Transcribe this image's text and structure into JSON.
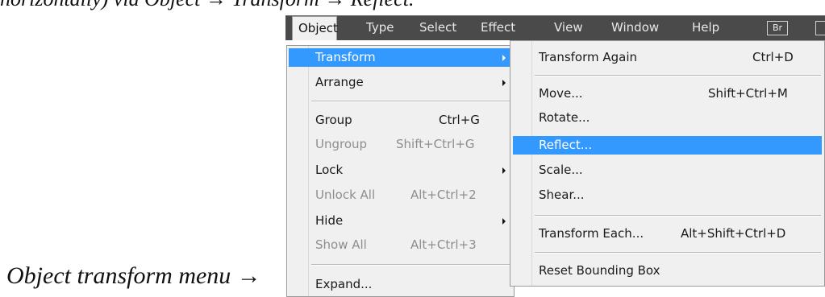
{
  "captions": {
    "top": "horizontally) via Object → Transform → Reflect.",
    "bottom": "Object transform menu →"
  },
  "menubar": {
    "items": [
      "Object",
      "Type",
      "Select",
      "Effect",
      "View",
      "Window",
      "Help"
    ],
    "badge": "Br"
  },
  "object_menu": {
    "items": [
      {
        "label": "Transform",
        "shortcut": "",
        "submenu": true,
        "highlighted": true
      },
      {
        "label": "Arrange",
        "shortcut": "",
        "submenu": true
      },
      {
        "label": "Group",
        "shortcut": "Ctrl+G"
      },
      {
        "label": "Ungroup",
        "shortcut": "Shift+Ctrl+G",
        "disabled": true
      },
      {
        "label": "Lock",
        "shortcut": "",
        "submenu": true
      },
      {
        "label": "Unlock All",
        "shortcut": "Alt+Ctrl+2",
        "disabled": true
      },
      {
        "label": "Hide",
        "shortcut": "",
        "submenu": true
      },
      {
        "label": "Show All",
        "shortcut": "Alt+Ctrl+3",
        "disabled": true
      },
      {
        "label": "Expand...",
        "shortcut": ""
      }
    ]
  },
  "transform_menu": {
    "items": [
      {
        "label": "Transform Again",
        "shortcut": "Ctrl+D"
      },
      {
        "label": "Move...",
        "shortcut": "Shift+Ctrl+M"
      },
      {
        "label": "Rotate...",
        "shortcut": ""
      },
      {
        "label": "Reflect...",
        "shortcut": "",
        "highlighted": true
      },
      {
        "label": "Scale...",
        "shortcut": ""
      },
      {
        "label": "Shear...",
        "shortcut": ""
      },
      {
        "label": "Transform Each...",
        "shortcut": "Alt+Shift+Ctrl+D"
      },
      {
        "label": "Reset Bounding Box",
        "shortcut": ""
      }
    ]
  },
  "colors": {
    "menubar_bg": "#4a4a4a",
    "menu_bg": "#f0f0f0",
    "highlight": "#3399ff"
  }
}
